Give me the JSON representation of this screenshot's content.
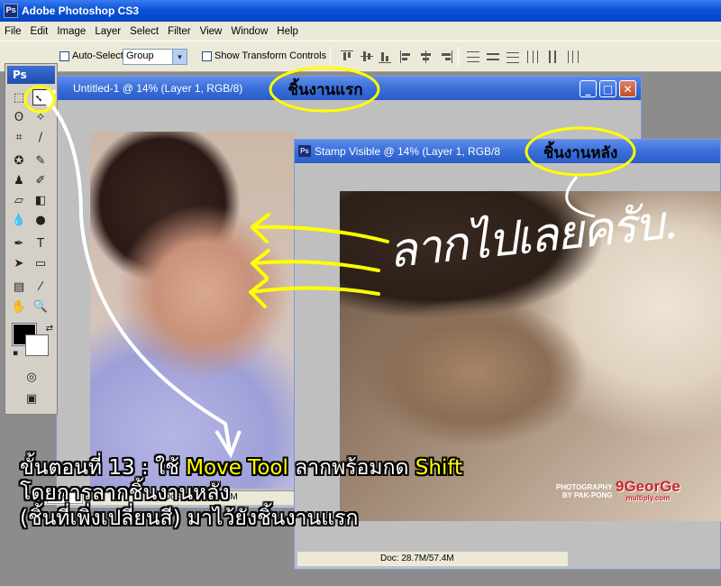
{
  "app": {
    "title": "Adobe Photoshop CS3",
    "logo": "Ps"
  },
  "menu": [
    "File",
    "Edit",
    "Image",
    "Layer",
    "Select",
    "Filter",
    "View",
    "Window",
    "Help"
  ],
  "options_bar": {
    "auto_select_label": "Auto-Select:",
    "auto_select_value": "Group",
    "show_transform_label": "Show Transform Controls"
  },
  "toolbox": {
    "header": "Ps",
    "tools": [
      "move-tool",
      "marquee-tool",
      "lasso-tool",
      "magic-wand-tool",
      "crop-tool",
      "slice-tool",
      "healing-brush-tool",
      "brush-tool",
      "clone-stamp-tool",
      "history-brush-tool",
      "eraser-tool",
      "gradient-tool",
      "blur-tool",
      "dodge-tool",
      "pen-tool",
      "type-tool",
      "path-selection-tool",
      "shape-tool",
      "notes-tool",
      "eyedropper-tool",
      "hand-tool",
      "zoom-tool",
      "quick-mask-mode",
      "screen-mode"
    ],
    "foreground_color": "#000000",
    "background_color": "#ffffff"
  },
  "documents": [
    {
      "title": "Untitled-1 @ 14% (Layer 1, RGB/8)",
      "zoom": "14%",
      "doc_size": "Doc: 28.7M/57.4M"
    },
    {
      "title": "Stamp Visible @ 14% (Layer 1, RGB/8",
      "doc_size": "Doc: 28.7M/57.4M"
    }
  ],
  "annotations": {
    "first_piece": "ชิ้นงานแรก",
    "second_piece": "ชิ้นงานหลัง",
    "scribble": "ลากไปเลยครับ.",
    "watermark_left": "PHOTOGRAPHY\nBY PAK-PONG",
    "watermark_right": "9GeorGe",
    "watermark_right_sub": "multiply.com",
    "accent_color": "#ffff00"
  },
  "instructions": {
    "line1_prefix": "ขั้นตอนที่ 13 : ใช้ ",
    "line1_tool": "Move Tool",
    "line1_mid": " ลากพร้อมกด ",
    "line1_key": "Shift",
    "line2": "โดยการลากชิ้นงานหลัง",
    "line3": "(ชิ้นที่เพิ่งเปลี่ยนสี) มาไว้ยังชิ้นงานแรก"
  }
}
